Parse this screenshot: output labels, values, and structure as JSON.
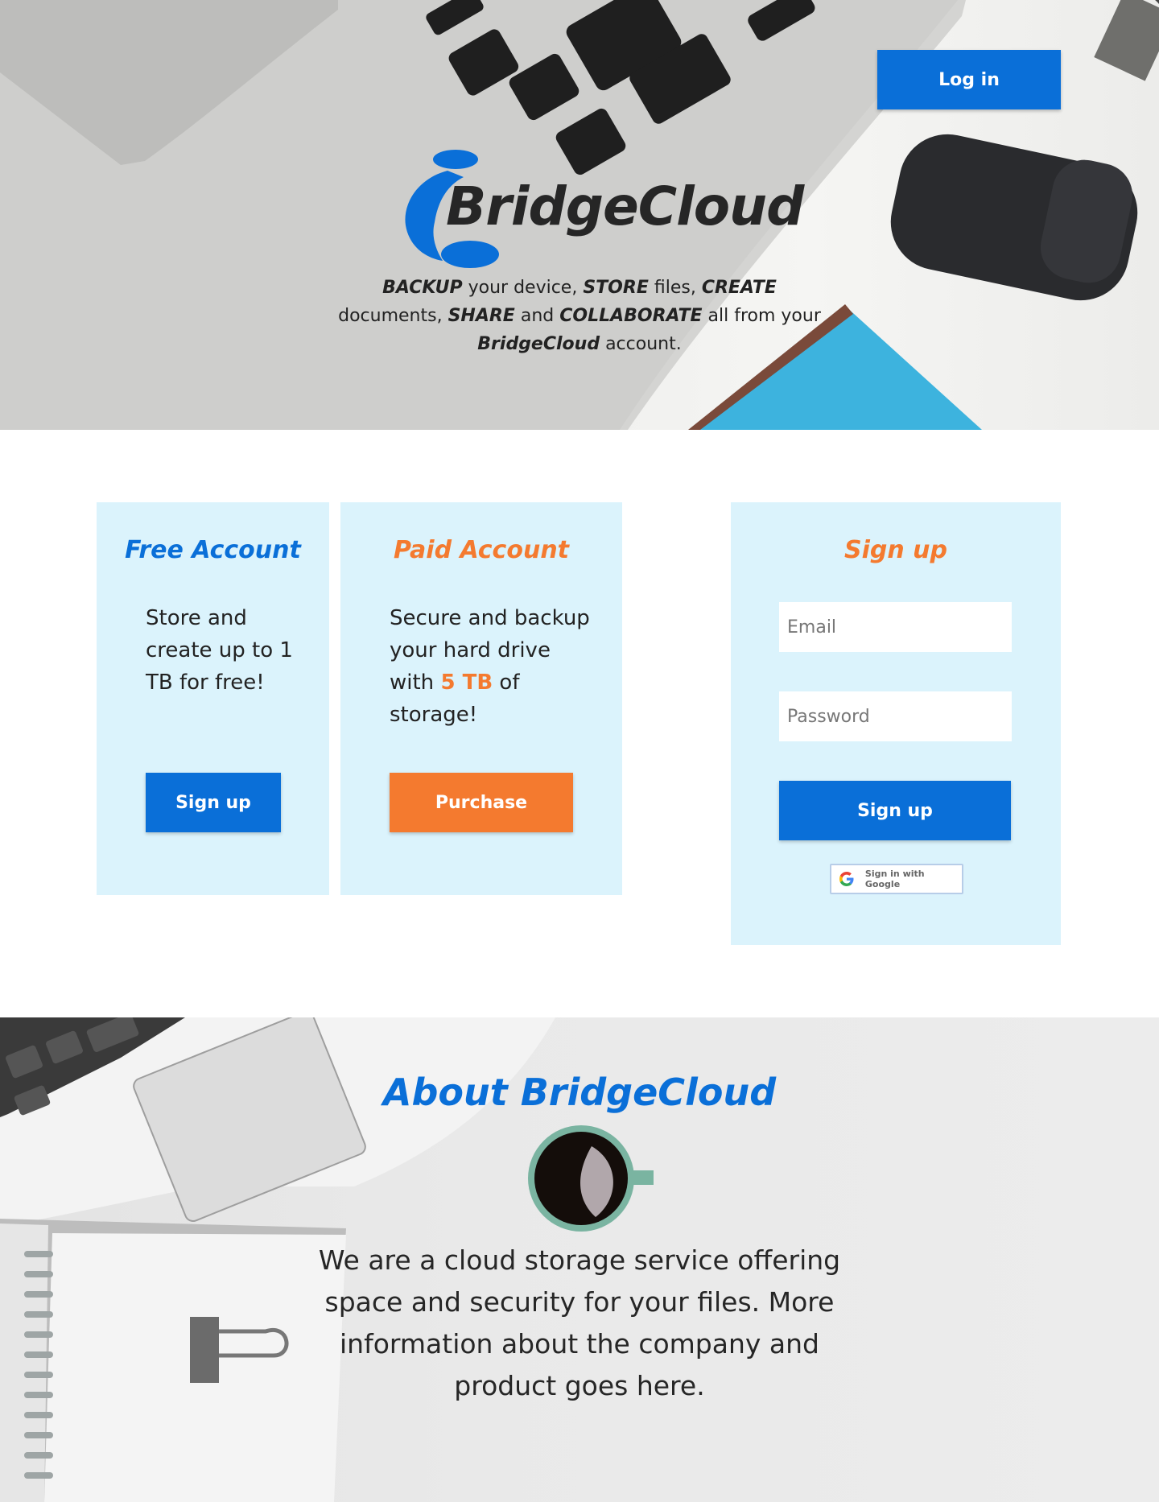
{
  "hero": {
    "login_label": "Log in",
    "logo_text": "BridgeCloud",
    "tagline": {
      "w1": "BACKUP",
      "t1": " your device, ",
      "w2": "STORE",
      "t2": " files, ",
      "w3": "CREATE",
      "t3": " documents, ",
      "w4": "SHARE",
      "t4": " and ",
      "w5": "COLLABORATE",
      "t5": " all from your ",
      "w6": "BridgeCloud",
      "t6": " account."
    }
  },
  "plans": {
    "free": {
      "title": "Free Account",
      "text": "Store and create up to 1 TB for free!",
      "button": "Sign up"
    },
    "paid": {
      "title": "Paid Account",
      "text_before": "Secure and backup your hard drive with ",
      "highlight": "5 TB",
      "text_after": " of storage!",
      "button": "Purchase"
    }
  },
  "signup": {
    "title": "Sign up",
    "email_placeholder": "Email",
    "password_placeholder": "Password",
    "button": "Sign up",
    "google_label": "Sign in with Google"
  },
  "about": {
    "title": "About BridgeCloud",
    "text": "We are a cloud storage service offering space and security for your files. More information about the company and product goes here."
  },
  "colors": {
    "brand_blue": "#0a6fd8",
    "brand_orange": "#f47a2f",
    "card_bg": "#dbf3fc"
  },
  "icons": {
    "logo": "bridgecloud-logo-icon",
    "google": "google-g-icon"
  }
}
